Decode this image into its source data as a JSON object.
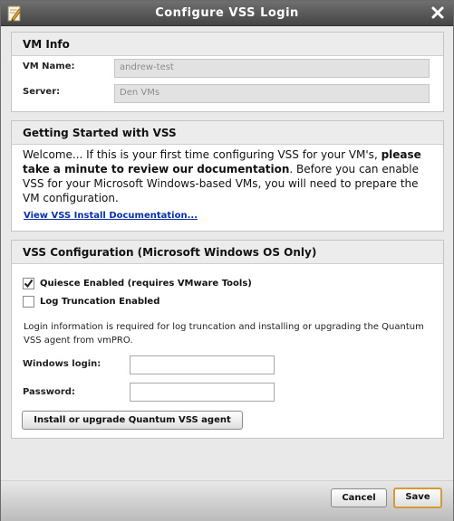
{
  "window": {
    "title": "Configure VSS Login"
  },
  "vm_info": {
    "heading": "VM Info",
    "vm_name_label": "VM Name:",
    "vm_name_value": "andrew-test",
    "server_label": "Server:",
    "server_value": "Den VMs"
  },
  "getting_started": {
    "heading": "Getting Started with VSS",
    "text_part1": "Welcome... If this is your first time configuring VSS for your VM's, ",
    "text_bold": "please take a minute to review our documentation",
    "text_part2": ". Before you can enable VSS for your Microsoft Windows-based VMs, you will need to prepare the VM configuration.",
    "doc_link": "View VSS Install Documentation..."
  },
  "vss_config": {
    "heading": "VSS Configuration (Microsoft Windows OS Only)",
    "quiesce_label": "Quiesce Enabled (requires VMware Tools)",
    "quiesce_checked": true,
    "log_trunc_label": "Log Truncation Enabled",
    "log_trunc_checked": false,
    "info": "Login information is required for log truncation and installing or upgrading the Quantum VSS agent from vmPRO.",
    "windows_login_label": "Windows login:",
    "windows_login_value": "",
    "password_label": "Password:",
    "password_value": "",
    "install_button": "Install or upgrade Quantum VSS agent"
  },
  "footer": {
    "cancel_label": "Cancel",
    "save_label": "Save"
  },
  "colors": {
    "titlebar": "#555555",
    "link": "#0b2fb0",
    "save_border": "#d59a34"
  },
  "icons": {
    "app": "edit-icon",
    "close": "close-icon",
    "check": "checkmark-icon"
  }
}
